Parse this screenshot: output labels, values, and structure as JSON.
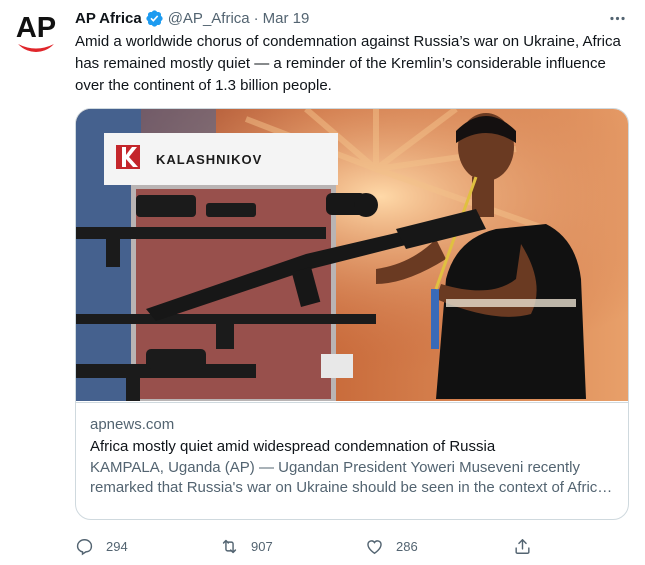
{
  "author": {
    "display_name": "AP Africa",
    "handle": "@AP_Africa",
    "separator": "·",
    "date": "Mar 19",
    "avatar_text": "AP",
    "verified": true
  },
  "tweet": {
    "text": "Amid a worldwide chorus of condemnation against Russia’s war on Ukraine, Africa has remained mostly quiet — a reminder of the Kremlin’s considerable influence over the continent of 1.3 billion people."
  },
  "card": {
    "image_sign_text": "KALASHNIKOV",
    "domain": "apnews.com",
    "title": "Africa mostly quiet amid widespread condemnation of Russia",
    "description": "KAMPALA, Uganda (AP) — Ugandan President Yoweri Museveni recently remarked that Russia's war on Ukraine should be seen in the context of Africa's relations with the West and Russia."
  },
  "actions": {
    "reply_count": "294",
    "retweet_count": "907",
    "like_count": "286"
  },
  "colors": {
    "text_primary": "#0f1419",
    "text_secondary": "#536471",
    "verified_blue": "#1d9bf0",
    "border": "#cfd9de",
    "ap_red": "#e0262b"
  },
  "icons": {
    "more": "more-options-icon",
    "reply": "reply-icon",
    "retweet": "retweet-icon",
    "like": "heart-icon",
    "share": "share-icon",
    "verified": "verified-badge-icon"
  }
}
